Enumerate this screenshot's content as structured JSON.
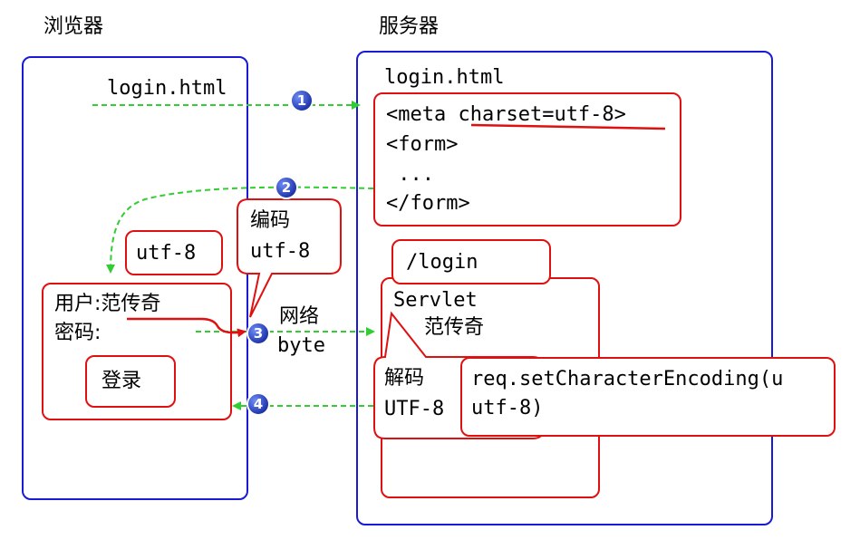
{
  "browser": {
    "title": "浏览器",
    "request_label": "login.html",
    "charset_box": "utf-8",
    "encode_bubble": {
      "line1": "编码",
      "line2": "utf-8"
    },
    "form": {
      "user_label": "用户:",
      "user_value": "范传奇",
      "password_label": "密码:",
      "login_button": "登录"
    }
  },
  "network": {
    "line1": "网络",
    "line2": "byte"
  },
  "server": {
    "title": "服务器",
    "file_label": "login.html",
    "html_code": {
      "line1_prefix": "<meta ",
      "line1_attr": "charset=utf-8",
      "line1_suffix": ">",
      "line2": "<form>",
      "line3": " ...",
      "line4": "</form>"
    },
    "servlet": {
      "path": "/login",
      "name": "Servlet",
      "value": "范传奇",
      "decode_bubble": {
        "line1": "解码",
        "line2": "UTF-8"
      },
      "code_bubble": {
        "line1": "req.setCharacterEncoding(u",
        "line2": "utf-8)"
      }
    }
  },
  "steps": [
    "1",
    "2",
    "3",
    "4"
  ],
  "colors": {
    "blue": "#1a1ad6",
    "red": "#e01010",
    "green": "#33cc33",
    "step_circle": "#1f3fbf"
  }
}
